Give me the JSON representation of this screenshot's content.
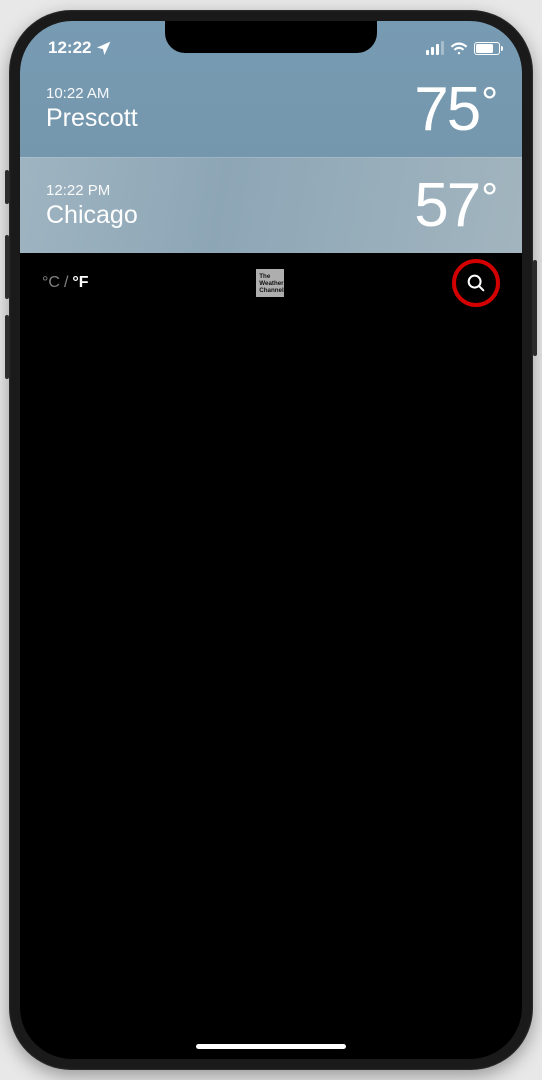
{
  "status": {
    "time": "12:22"
  },
  "cities": [
    {
      "time": "10:22 AM",
      "name": "Prescott",
      "temp": "75"
    },
    {
      "time": "12:22 PM",
      "name": "Chicago",
      "temp": "57"
    }
  ],
  "footer": {
    "unit_c": "°C",
    "divider": "/",
    "unit_f": "°F",
    "twc_l1": "The",
    "twc_l2": "Weather",
    "twc_l3": "Channel"
  }
}
